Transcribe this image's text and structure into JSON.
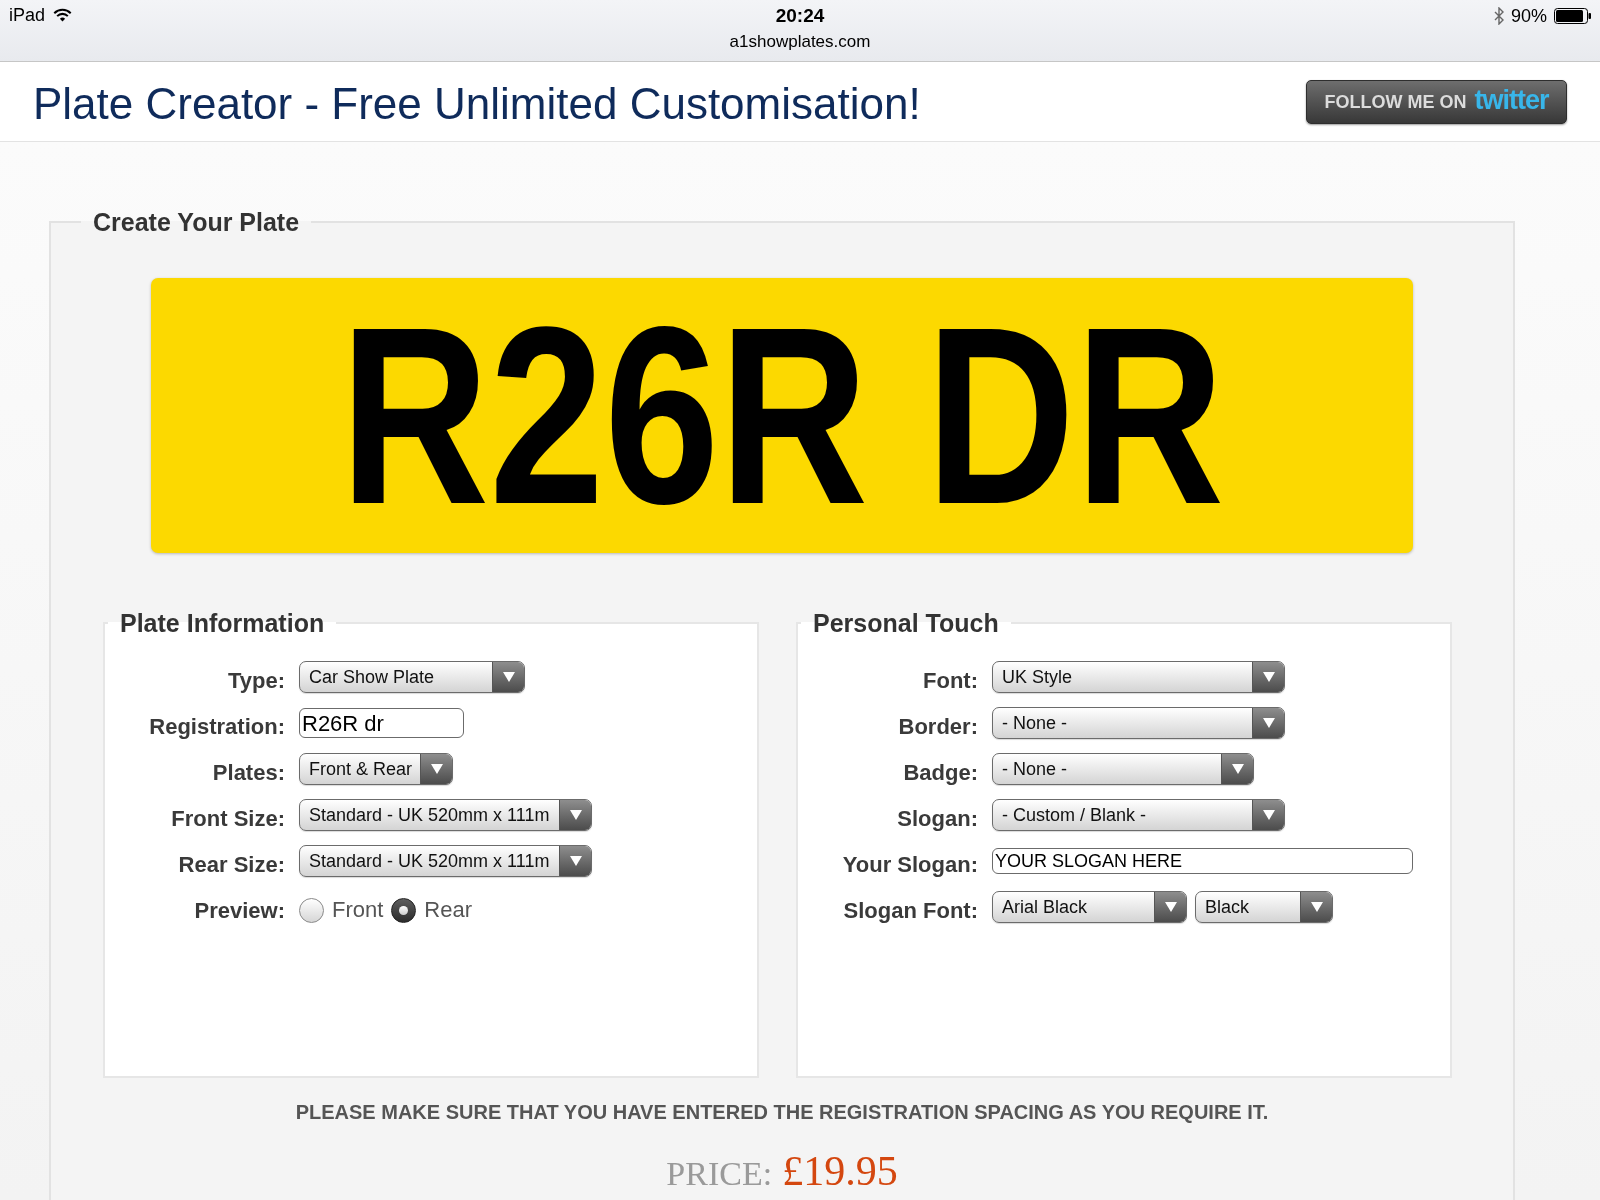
{
  "status_bar": {
    "device": "iPad",
    "time": "20:24",
    "url": "a1showplates.com",
    "battery": "90%"
  },
  "header": {
    "title": "Plate Creator - Free Unlimited Customisation!",
    "follow_button": {
      "label": "FOLLOW ME ON",
      "logo_text": "twitter"
    }
  },
  "plate_creator": {
    "title": "Create Your Plate",
    "plate_preview": {
      "text": "R26R DR"
    },
    "plate_information": {
      "title": "Plate Information",
      "fields": [
        {
          "kind": "select",
          "label": "Type:",
          "value": "Car Show Plate"
        },
        {
          "kind": "input",
          "label": "Registration:",
          "value": "R26R dr"
        },
        {
          "kind": "select",
          "label": "Plates:",
          "value": "Front & Rear"
        },
        {
          "kind": "select",
          "label": "Front Size:",
          "value": "Standard - UK 520mm x 111m"
        },
        {
          "kind": "select",
          "label": "Rear Size:",
          "value": "Standard - UK 520mm x 111m"
        },
        {
          "kind": "radio",
          "label": "Preview:",
          "options": [
            {
              "label": "Front",
              "selected": false
            },
            {
              "label": "Rear",
              "selected": true
            }
          ]
        }
      ]
    },
    "personal_touch": {
      "title": "Personal Touch",
      "fields": [
        {
          "kind": "select",
          "label": "Font:",
          "value": "UK Style"
        },
        {
          "kind": "select",
          "label": "Border:",
          "value": "- None -"
        },
        {
          "kind": "select",
          "label": "Badge:",
          "value": "- None -"
        },
        {
          "kind": "select",
          "label": "Slogan:",
          "value": "- Custom / Blank -"
        },
        {
          "kind": "input",
          "label": "Your Slogan:",
          "value": "YOUR SLOGAN HERE"
        },
        {
          "kind": "selects",
          "label": "Slogan Font:",
          "selects": [
            {
              "value": "Arial Black"
            },
            {
              "value": "Black"
            }
          ]
        }
      ]
    },
    "notice": "PLEASE MAKE SURE THAT YOU HAVE ENTERED THE REGISTRATION SPACING AS YOU REQUIRE IT.",
    "price": {
      "label": "PRICE:",
      "amount": "£19.95"
    }
  }
}
